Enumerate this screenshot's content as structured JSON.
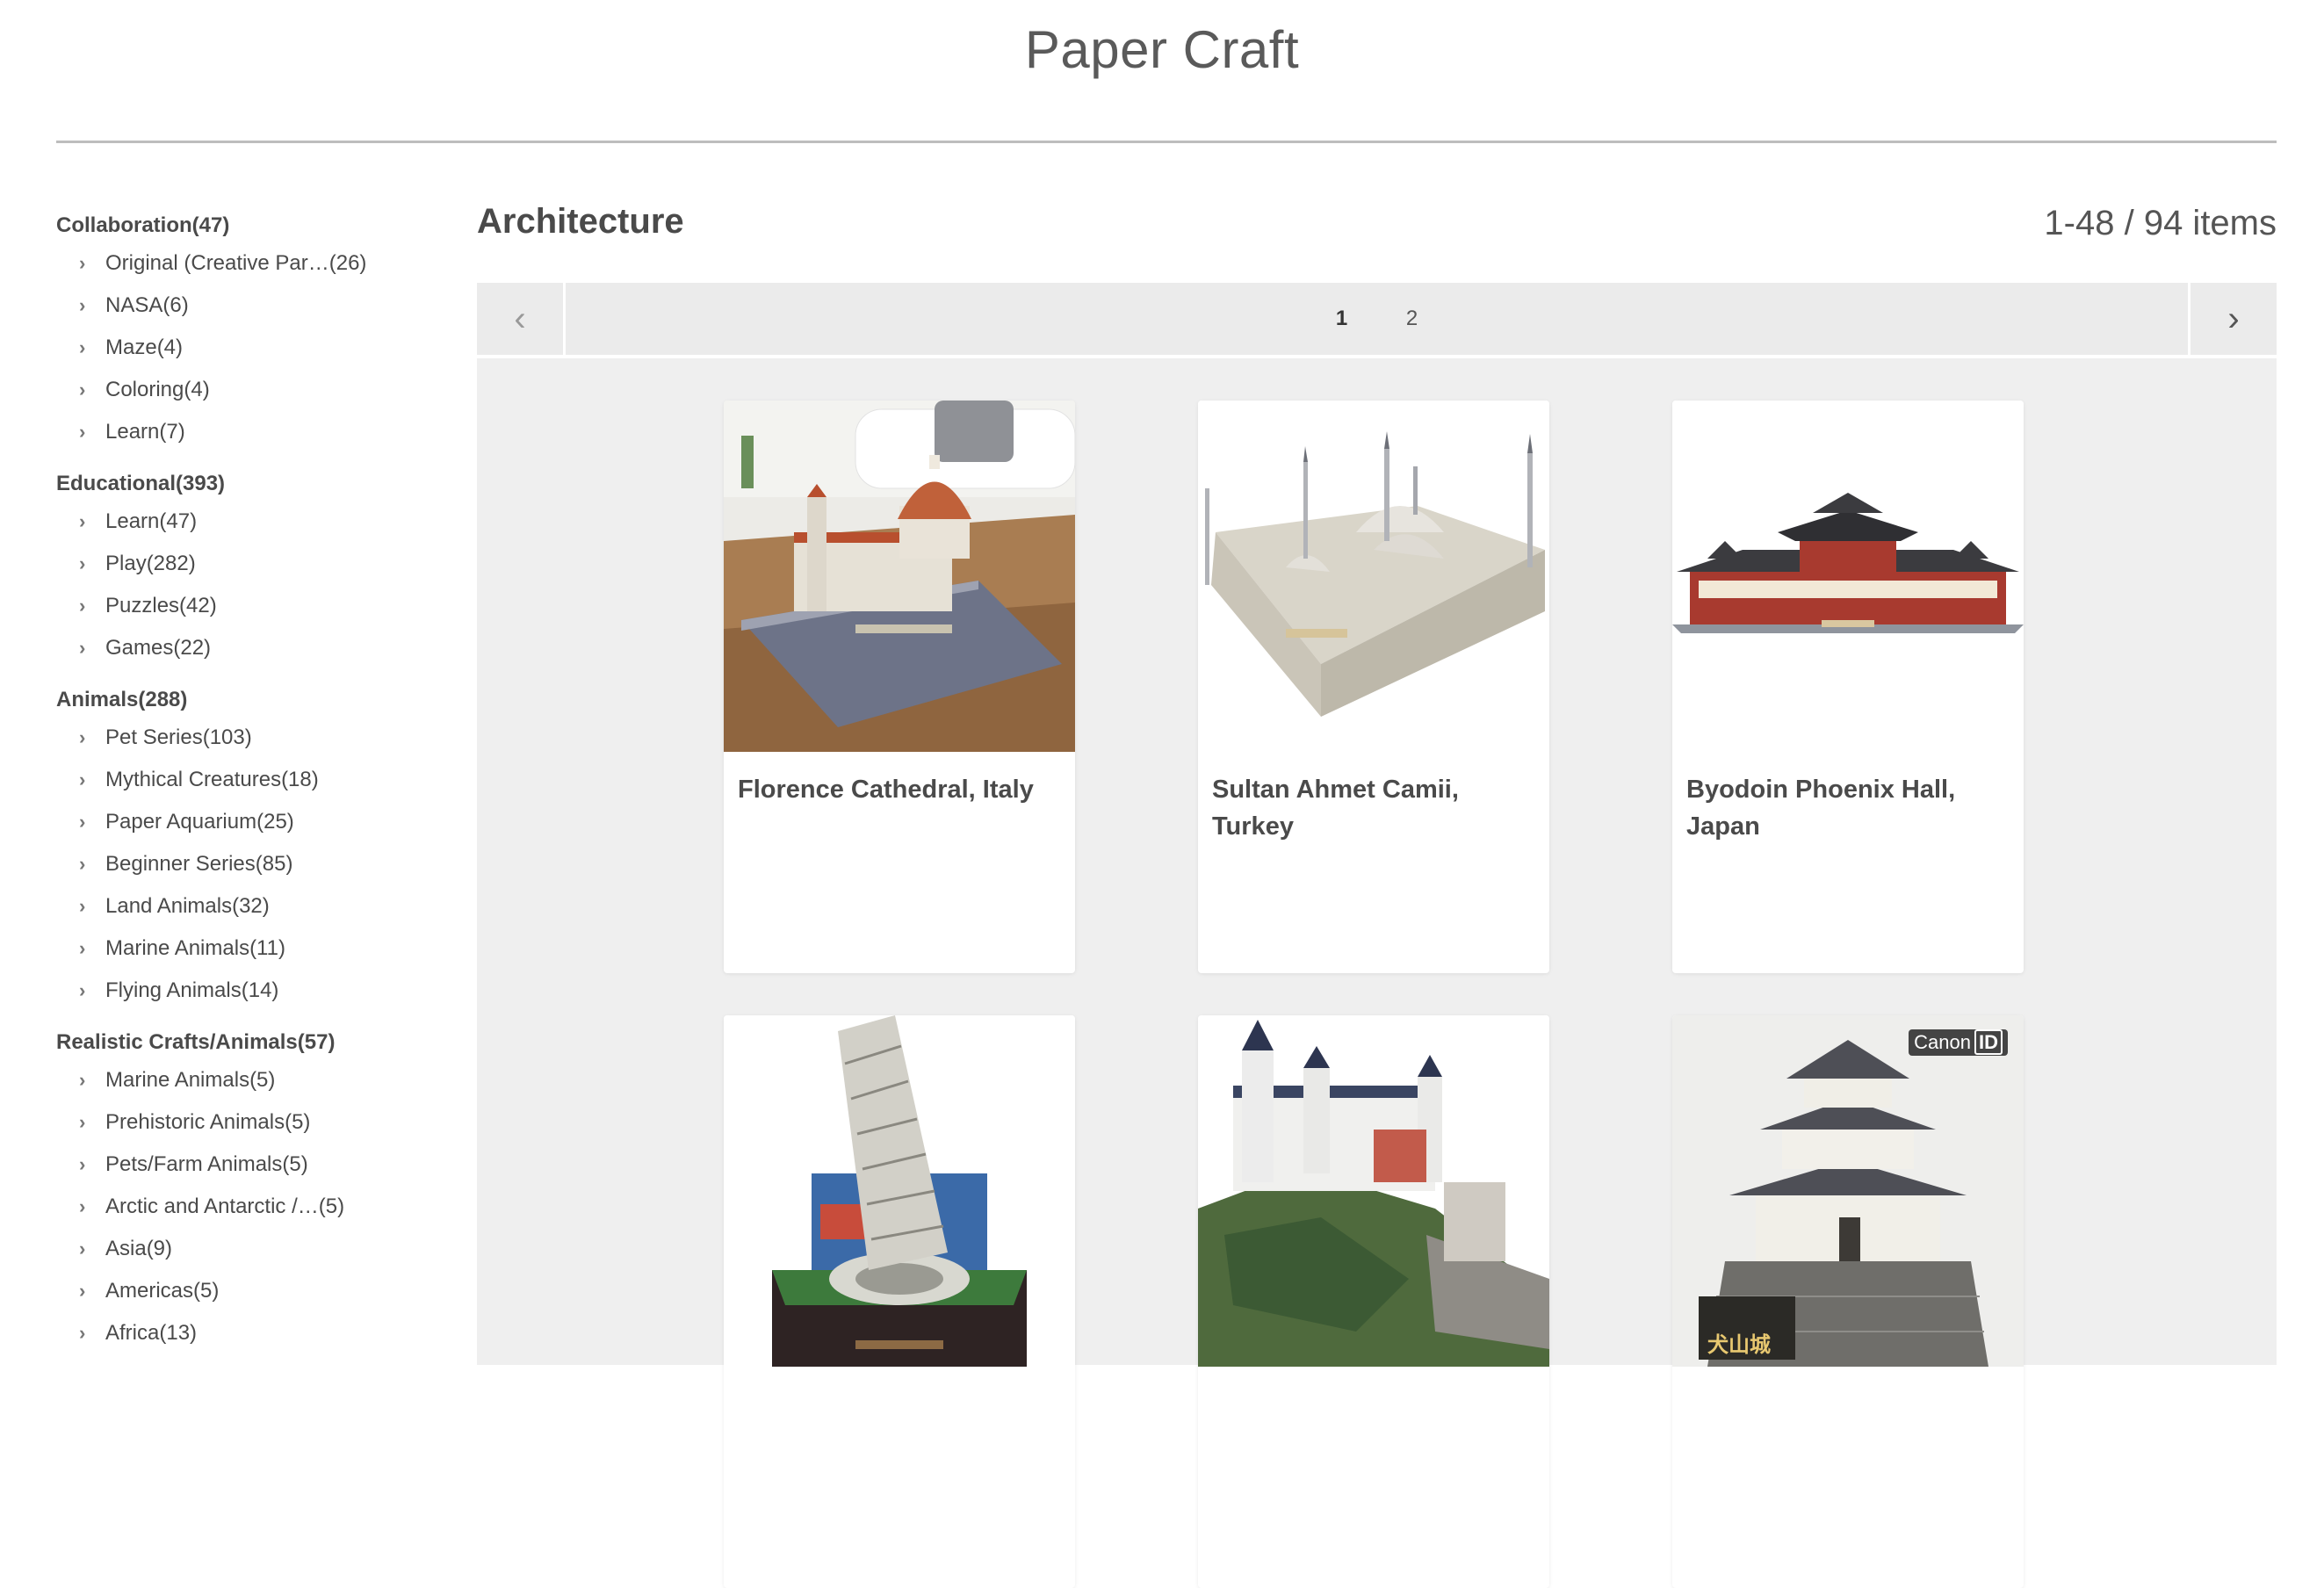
{
  "site": {
    "title": "Paper Craft"
  },
  "sidebar": {
    "groups": [
      {
        "title": "Collaboration(47)",
        "items": [
          "Original (Creative Par…(26)",
          "NASA(6)",
          "Maze(4)",
          "Coloring(4)",
          "Learn(7)"
        ]
      },
      {
        "title": "Educational(393)",
        "items": [
          "Learn(47)",
          "Play(282)",
          "Puzzles(42)",
          "Games(22)"
        ]
      },
      {
        "title": "Animals(288)",
        "items": [
          "Pet Series(103)",
          "Mythical Creatures(18)",
          "Paper Aquarium(25)",
          "Beginner Series(85)",
          "Land Animals(32)",
          "Marine Animals(11)",
          "Flying Animals(14)"
        ]
      },
      {
        "title": "Realistic Crafts/Animals(57)",
        "items": [
          "Marine Animals(5)",
          "Prehistoric Animals(5)",
          "Pets/Farm Animals(5)",
          "Arctic and Antarctic /…(5)",
          "Asia(9)",
          "Americas(5)",
          "Africa(13)"
        ]
      }
    ]
  },
  "main": {
    "heading": "Architecture",
    "count": "1-48 / 94 items",
    "pager": {
      "prev": "‹",
      "next": "›",
      "pages": [
        "1",
        "2"
      ],
      "current": "1"
    },
    "cards": [
      {
        "caption": "Florence Cathedral, Italy",
        "image": "florence-cathedral-image"
      },
      {
        "caption": "Sultan Ahmet Camii, Turkey",
        "image": "sultan-ahmet-camii-image"
      },
      {
        "caption": "Byodoin Phoenix Hall, Japan",
        "image": "byodoin-phoenix-hall-image"
      },
      {
        "caption": "",
        "image": "leaning-tower-image"
      },
      {
        "caption": "",
        "image": "castle-image"
      },
      {
        "caption": "",
        "image": "inuyama-castle-image",
        "badge": {
          "brand": "Canon",
          "id": "ID"
        },
        "plaque": "犬山城"
      }
    ]
  },
  "colors": {
    "background": "#ffffff",
    "panel": "#efefef",
    "pager": "#ebebeb",
    "text": "#4a4a4a",
    "dome": "#c0613a"
  }
}
